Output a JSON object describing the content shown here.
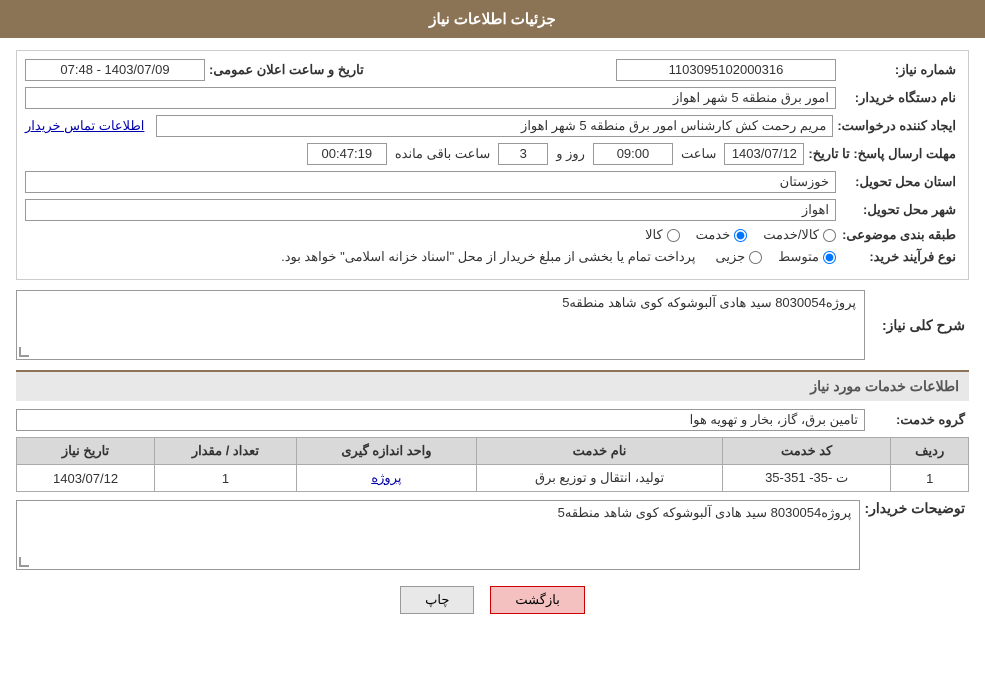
{
  "header": {
    "title": "جزئیات اطلاعات نیاز"
  },
  "fields": {
    "need_number_label": "شماره نیاز:",
    "need_number_value": "1103095102000316",
    "buyer_name_label": "نام دستگاه خریدار:",
    "buyer_name_value": "امور برق منطقه 5 شهر اهواز",
    "creator_label": "ایجاد کننده درخواست:",
    "creator_value": "مریم رحمت کش کارشناس امور برق منطقه 5 شهر اهواز",
    "contact_link": "اطلاعات تماس خریدار",
    "announce_datetime_label": "تاریخ و ساعت اعلان عمومی:",
    "announce_datetime_value": "1403/07/09 - 07:48",
    "response_deadline_label": "مهلت ارسال پاسخ: تا تاریخ:",
    "response_date_value": "1403/07/12",
    "response_time_label": "ساعت",
    "response_time_value": "09:00",
    "response_days_label": "روز و",
    "response_days_value": "3",
    "remaining_label": "ساعت باقی مانده",
    "remaining_value": "00:47:19",
    "province_label": "استان محل تحویل:",
    "province_value": "خوزستان",
    "city_label": "شهر محل تحویل:",
    "city_value": "اهواز",
    "category_label": "طبقه بندی موضوعی:",
    "category_options": [
      "کالا",
      "خدمت",
      "کالا/خدمت"
    ],
    "category_selected": "خدمت",
    "purchase_type_label": "نوع فرآیند خرید:",
    "purchase_type_options": [
      "جزیی",
      "متوسط"
    ],
    "purchase_type_note": "پرداخت تمام یا بخشی از مبلغ خریدار از محل \"اسناد خزانه اسلامی\" خواهد بود.",
    "need_description_label": "شرح کلی نیاز:",
    "need_description_value": "پروژه8030054 سید هادی آلبوشوکه کوی شاهد منطقه5",
    "services_title": "اطلاعات خدمات مورد نیاز",
    "service_group_label": "گروه خدمت:",
    "service_group_value": "تامین برق، گاز، بخار و تهویه هوا",
    "table": {
      "headers": [
        "ردیف",
        "کد خدمت",
        "نام خدمت",
        "واحد اندازه گیری",
        "تعداد / مقدار",
        "تاریخ نیاز"
      ],
      "rows": [
        {
          "row": "1",
          "code": "ت -35- 351-35",
          "name": "تولید، انتقال و توزیع برق",
          "unit": "پروژه",
          "quantity": "1",
          "date": "1403/07/12"
        }
      ]
    },
    "buyer_desc_label": "توضیحات خریدار:",
    "buyer_desc_value": "پروژه8030054 سید هادی آلبوشوکه کوی شاهد منطقه5"
  },
  "buttons": {
    "print_label": "چاپ",
    "back_label": "بازگشت"
  }
}
